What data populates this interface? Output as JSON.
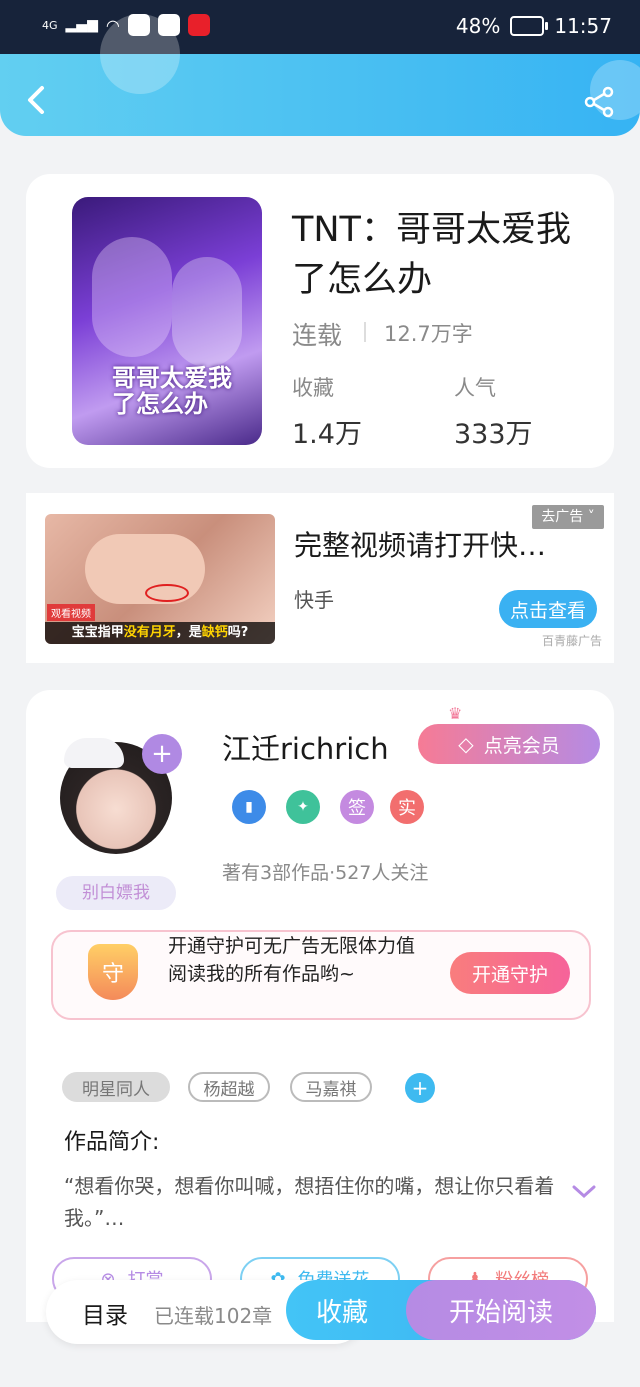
{
  "status": {
    "network": "4G",
    "battery": "48%",
    "time": "11:57"
  },
  "book": {
    "title": "TNT：哥哥太爱我了怎么办",
    "state": "连载",
    "words": "12.7万字",
    "collect_label": "收藏",
    "collect_value": "1.4万",
    "popularity_label": "人气",
    "popularity_value": "333万",
    "cover_text": "哥哥太爱我了怎么办"
  },
  "ad": {
    "close_label": "去广告",
    "title": "完整视频请打开快…",
    "source": "快手",
    "button": "点击查看",
    "provider": "百青藤广告",
    "video_badge": "观看视频",
    "caption_prefix": "宝宝指甲",
    "caption_highlight1": "没有月牙",
    "caption_middle": "，是",
    "caption_highlight2": "缺钙",
    "caption_suffix": "吗?"
  },
  "author": {
    "name": "江迁richrich",
    "vip_button": "点亮会员",
    "badges": [
      "签",
      "实"
    ],
    "stats": "著有3部作品·527人关注",
    "tagline": "别白嫖我",
    "guard_text": "开通守护可无广告无限体力值阅读我的所有作品哟~",
    "guard_icon": "守",
    "guard_button": "开通守护"
  },
  "tags": [
    "明星同人",
    "杨超越",
    "马嘉祺"
  ],
  "intro": {
    "heading": "作品简介:",
    "text": "“想看你哭，想看你叫喊，想捂住你的嘴，想让你只看着我。”…"
  },
  "actions": [
    "打赏",
    "免费送花",
    "粉丝榜"
  ],
  "bottom": {
    "toc": "目录",
    "chapters": "已连载102章",
    "collect": "收藏",
    "read": "开始阅读"
  }
}
